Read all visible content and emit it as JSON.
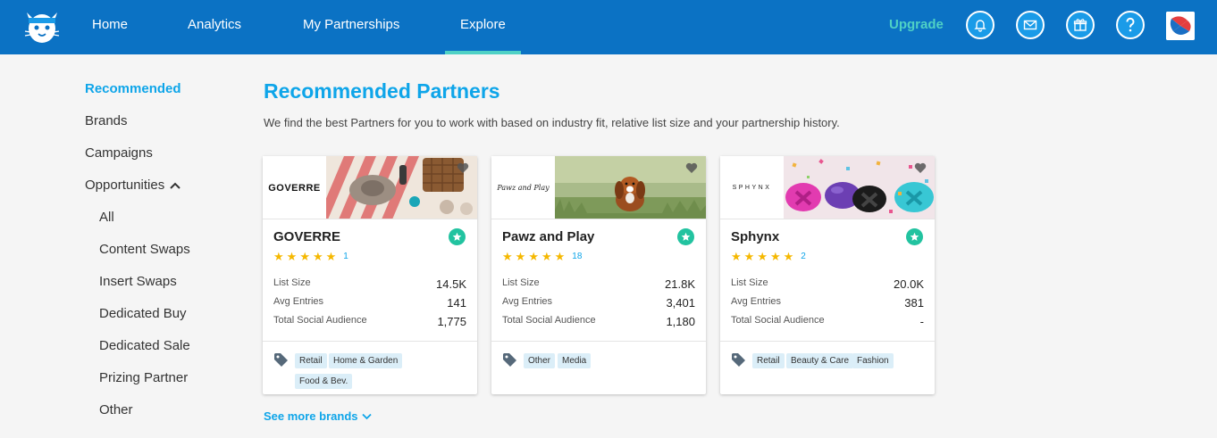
{
  "nav": {
    "items": [
      {
        "label": "Home"
      },
      {
        "label": "Analytics"
      },
      {
        "label": "My Partnerships"
      },
      {
        "label": "Explore",
        "active": true
      }
    ],
    "upgrade": "Upgrade",
    "icons": [
      "bell-icon",
      "mail-icon",
      "gift-icon",
      "help-icon"
    ]
  },
  "sidebar": {
    "items": [
      {
        "label": "Recommended",
        "active": true
      },
      {
        "label": "Brands"
      },
      {
        "label": "Campaigns"
      },
      {
        "label": "Opportunities"
      }
    ],
    "sub_items": [
      {
        "label": "All"
      },
      {
        "label": "Content Swaps"
      },
      {
        "label": "Insert Swaps"
      },
      {
        "label": "Dedicated Buy"
      },
      {
        "label": "Dedicated Sale"
      },
      {
        "label": "Prizing Partner"
      },
      {
        "label": "Other"
      }
    ]
  },
  "main": {
    "title": "Recommended Partners",
    "description": "We find the best Partners for you to work with based on industry fit, relative list size and your partnership history.",
    "see_more": "See more brands"
  },
  "stat_labels": {
    "list_size": "List Size",
    "avg_entries": "Avg Entries",
    "social": "Total Social Audience"
  },
  "cards": [
    {
      "name": "GOVERRE",
      "logo_text": "GOVERRE",
      "rating": 5,
      "reviews": "1",
      "list_size": "14.5K",
      "avg_entries": "141",
      "social": "1,775",
      "tags": [
        "Retail",
        "Home & Garden",
        "Food & Bev."
      ]
    },
    {
      "name": "Pawz and Play",
      "logo_text": "Pawz and Play",
      "rating": 5,
      "reviews": "18",
      "list_size": "21.8K",
      "avg_entries": "3,401",
      "social": "1,180",
      "tags": [
        "Other",
        "Media"
      ]
    },
    {
      "name": "Sphynx",
      "logo_text": "SPHYNX",
      "rating": 5,
      "reviews": "2",
      "list_size": "20.0K",
      "avg_entries": "381",
      "social": "-",
      "tags": [
        "Retail",
        "Beauty & Care",
        "Fashion"
      ]
    }
  ],
  "colors": {
    "topbar": "#0b72c4",
    "accent": "#0ea5e9",
    "teal": "#4fd1c5",
    "featured": "#22c3a0",
    "star": "#f5b800"
  }
}
